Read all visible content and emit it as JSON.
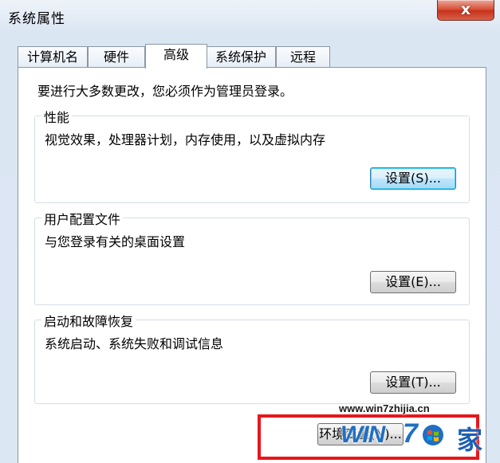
{
  "window": {
    "title": "系统属性",
    "close_label": "x"
  },
  "tabs": [
    {
      "label": "计算机名",
      "active": false
    },
    {
      "label": "硬件",
      "active": false
    },
    {
      "label": "高级",
      "active": true
    },
    {
      "label": "系统保护",
      "active": false
    },
    {
      "label": "远程",
      "active": false
    }
  ],
  "panel": {
    "admin_note": "要进行大多数更改，您必须作为管理员登录。",
    "groups": [
      {
        "title": "性能",
        "description": "视觉效果，处理器计划，内存使用，以及虚拟内存",
        "button": "设置(S)..."
      },
      {
        "title": "用户配置文件",
        "description": "与您登录有关的桌面设置",
        "button": "设置(E)..."
      },
      {
        "title": "启动和故障恢复",
        "description": "系统启动、系统失败和调试信息",
        "button": "设置(T)..."
      }
    ],
    "env_button": "环境变量(N)..."
  },
  "watermark": {
    "url": "www.win7zhijia.cn",
    "logo_win": "WIN",
    "logo_seven": "7",
    "logo_jia": "家"
  },
  "colors": {
    "highlight": "#e8161c",
    "window_bg": "#dce7f4",
    "watermark_blue": "#1f6fc4"
  }
}
